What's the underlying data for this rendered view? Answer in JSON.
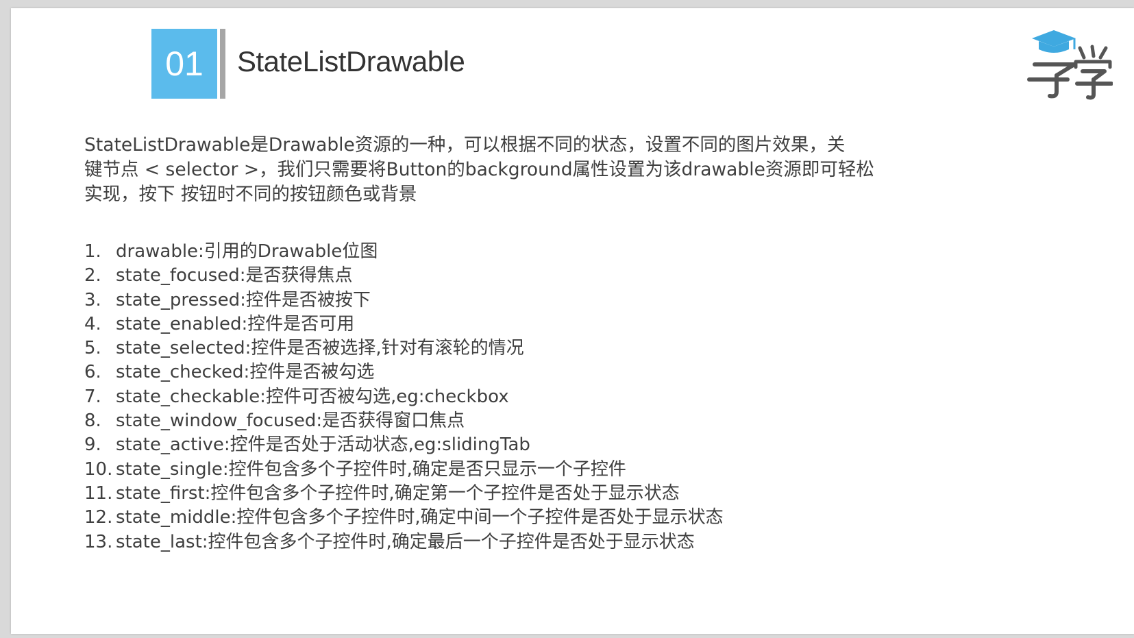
{
  "header": {
    "number": "01",
    "title": "StateListDrawable"
  },
  "logo": {
    "icon": "graduation-cap-icon",
    "accent_color": "#3fa9e0",
    "text_color": "#555555"
  },
  "intro": {
    "lines": [
      "StateListDrawable是Drawable资源的一种，可以根据不同的状态，设置不同的图片效果，关",
      "键节点 < selector >，我们只需要将Button的background属性设置为该drawable资源即可轻松",
      "实现，按下 按钮时不同的按钮颜色或背景"
    ]
  },
  "list": [
    {
      "num": "1.",
      "text": "drawable:引用的Drawable位图"
    },
    {
      "num": "2.",
      "text": "state_focused:是否获得焦点"
    },
    {
      "num": "3.",
      "text": "state_pressed:控件是否被按下"
    },
    {
      "num": "4.",
      "text": "state_enabled:控件是否可用"
    },
    {
      "num": "5.",
      "text": "state_selected:控件是否被选择,针对有滚轮的情况"
    },
    {
      "num": "6.",
      "text": "state_checked:控件是否被勾选"
    },
    {
      "num": "7.",
      "text": "state_checkable:控件可否被勾选,eg:checkbox"
    },
    {
      "num": "8.",
      "text": "state_window_focused:是否获得窗口焦点"
    },
    {
      "num": "9.",
      "text": "state_active:控件是否处于活动状态,eg:slidingTab"
    },
    {
      "num": "10.",
      "text": "state_single:控件包含多个子控件时,确定是否只显示一个子控件"
    },
    {
      "num": "11.",
      "text": "state_first:控件包含多个子控件时,确定第一个子控件是否处于显示状态"
    },
    {
      "num": "12.",
      "text": "state_middle:控件包含多个子控件时,确定中间一个子控件是否处于显示状态"
    },
    {
      "num": "13.",
      "text": "state_last:控件包含多个子控件时,确定最后一个子控件是否处于显示状态"
    }
  ]
}
